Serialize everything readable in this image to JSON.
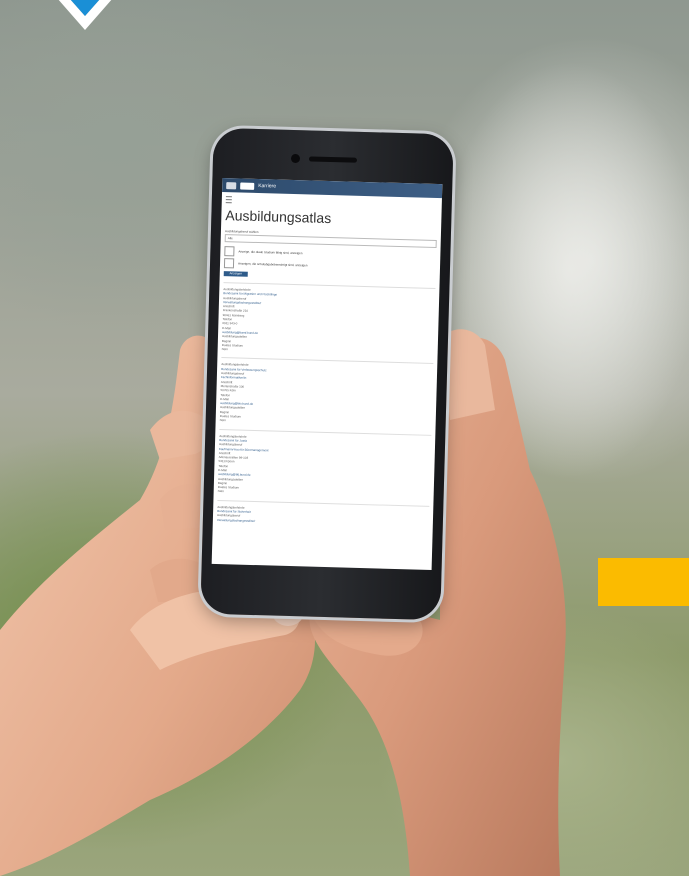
{
  "scene": {
    "accent_color": "#fbbb00",
    "brand_color": "#1a8fd6"
  },
  "screen": {
    "site_name": "Karriere",
    "page_title": "Ausbildungsatlas",
    "select_label": "Ausbildungsberuf wählen",
    "select_value": "Alle",
    "checkbox_1_label": "Anzeige, die duale Studium fähig sind, anzeigen",
    "checkbox_2_label": "Anzeigen, die schulabgabeberechtigt sind, anzeigen",
    "submit_label": "Anzeigen",
    "results": [
      {
        "lines": [
          {
            "text": "Ausbildungsbehörde",
            "link": false
          },
          {
            "text": "Bundesamt für Migration und Flüchtlinge",
            "link": true
          },
          {
            "text": "Ausbildungsberuf",
            "link": false
          },
          {
            "text": "Verwaltungsfachangestellte/r",
            "link": true
          },
          {
            "text": "Anschrift",
            "link": false
          },
          {
            "text": "Frankenstraße 210",
            "link": false
          },
          {
            "text": "90461 Nürnberg",
            "link": false
          },
          {
            "text": "Telefon",
            "link": false
          },
          {
            "text": "0911 943-0",
            "link": false
          },
          {
            "text": "E-Mail",
            "link": false
          },
          {
            "text": "ausbildung@bamf.bund.de",
            "link": true
          },
          {
            "text": "Ausbildungsstellen",
            "link": false
          },
          {
            "text": "Beginn",
            "link": false
          },
          {
            "text": "Duales Studium",
            "link": false
          },
          {
            "text": "Nein",
            "link": false
          }
        ]
      },
      {
        "lines": [
          {
            "text": "Ausbildungsbehörde",
            "link": false
          },
          {
            "text": "Bundesamt für Verfassungsschutz",
            "link": true
          },
          {
            "text": "Ausbildungsberuf",
            "link": false
          },
          {
            "text": "Fachinformatiker/in",
            "link": true
          },
          {
            "text": "Anschrift",
            "link": false
          },
          {
            "text": "Merianstraße 100",
            "link": false
          },
          {
            "text": "50765 Köln",
            "link": false
          },
          {
            "text": "Telefon",
            "link": false
          },
          {
            "text": "E-Mail",
            "link": false
          },
          {
            "text": "ausbildung@bfv.bund.de",
            "link": true
          },
          {
            "text": "Ausbildungsstellen",
            "link": false
          },
          {
            "text": "Beginn",
            "link": false
          },
          {
            "text": "Duales Studium",
            "link": false
          },
          {
            "text": "Nein",
            "link": false
          }
        ]
      },
      {
        "lines": [
          {
            "text": "Ausbildungsbehörde",
            "link": false
          },
          {
            "text": "Bundesamt für Justiz",
            "link": true
          },
          {
            "text": "Ausbildungsberuf",
            "link": false
          },
          {
            "text": "Kaufmann/-frau für Büromanagement",
            "link": true
          },
          {
            "text": "Anschrift",
            "link": false
          },
          {
            "text": "Adenauerallee 99-103",
            "link": false
          },
          {
            "text": "53113 Bonn",
            "link": false
          },
          {
            "text": "Telefon",
            "link": false
          },
          {
            "text": "E-Mail",
            "link": false
          },
          {
            "text": "ausbildung@bfj.bund.de",
            "link": true
          },
          {
            "text": "Ausbildungsstellen",
            "link": false
          },
          {
            "text": "Beginn",
            "link": false
          },
          {
            "text": "Duales Studium",
            "link": false
          },
          {
            "text": "Nein",
            "link": false
          }
        ]
      },
      {
        "lines": [
          {
            "text": "Ausbildungsbehörde",
            "link": false
          },
          {
            "text": "Bundesamt für Sicherheit",
            "link": true
          },
          {
            "text": "Ausbildungsberuf",
            "link": false
          },
          {
            "text": "Verwaltungsfachangestellte/r",
            "link": true
          }
        ]
      }
    ]
  }
}
